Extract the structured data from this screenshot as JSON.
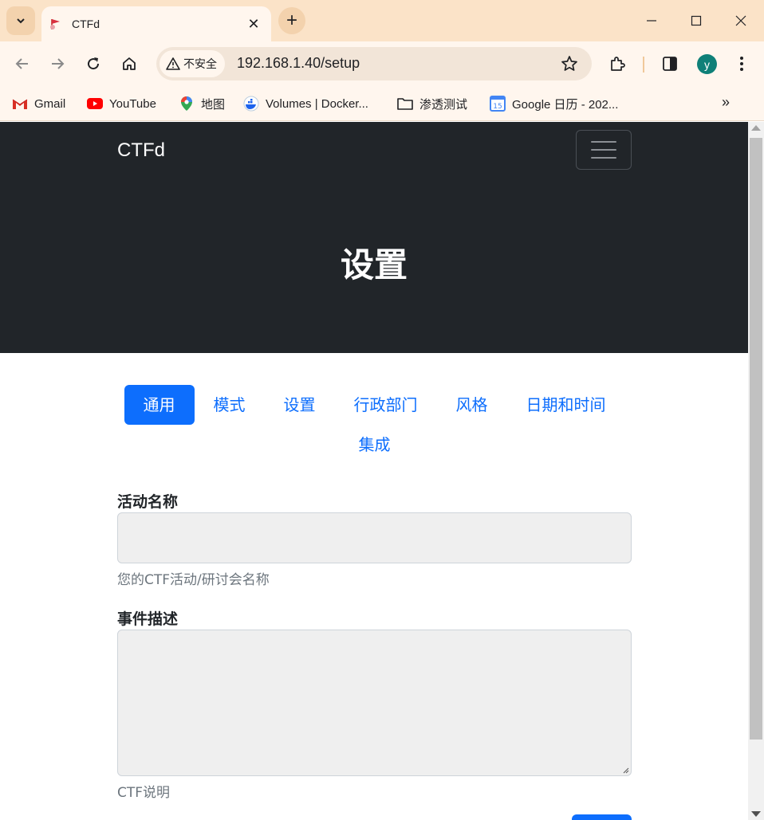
{
  "browser": {
    "tab_title": "CTFd",
    "security_chip": "不安全",
    "url": "192.168.1.40/setup",
    "profile_initial": "y",
    "bookmarks": [
      {
        "label": "Gmail",
        "icon": "gmail-icon"
      },
      {
        "label": "YouTube",
        "icon": "youtube-icon"
      },
      {
        "label": "地图",
        "icon": "maps-icon"
      },
      {
        "label": "Volumes | Docker...",
        "icon": "docker-icon"
      },
      {
        "label": "渗透测试",
        "icon": "folder-icon"
      },
      {
        "label": "Google 日历 - 202...",
        "icon": "calendar-icon"
      }
    ],
    "colors": {
      "tabstrip": "#fbe3c8",
      "toolbar": "#fff6ee"
    }
  },
  "page": {
    "brand": "CTFd",
    "title": "设置",
    "tabs": [
      {
        "label": "通用",
        "active": true
      },
      {
        "label": "模式",
        "active": false
      },
      {
        "label": "设置",
        "active": false
      },
      {
        "label": "行政部门",
        "active": false
      },
      {
        "label": "风格",
        "active": false
      },
      {
        "label": "日期和时间",
        "active": false
      },
      {
        "label": "集成",
        "active": false
      }
    ],
    "form": {
      "event_name_label": "活动名称",
      "event_name_value": "",
      "event_name_help": "您的CTF活动/研讨会名称",
      "description_label": "事件描述",
      "description_value": "",
      "description_help": "CTF说明"
    },
    "colors": {
      "primary": "#0d6efd",
      "dark": "#212529"
    }
  }
}
